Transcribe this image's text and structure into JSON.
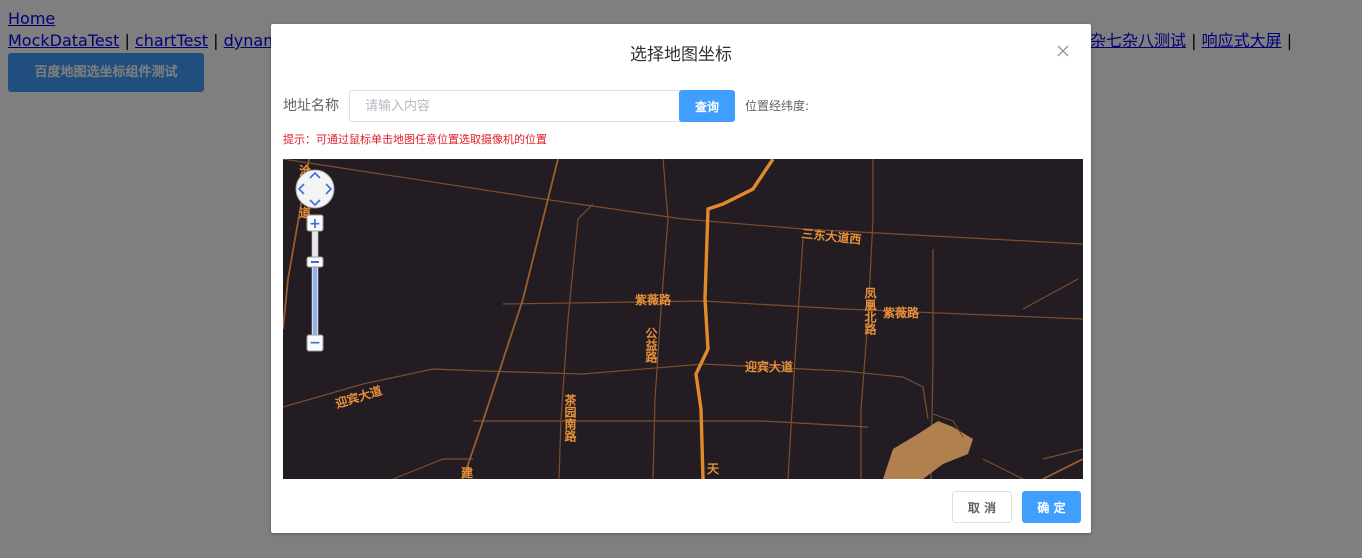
{
  "background": {
    "nav_home": "Home",
    "nav_links": [
      "MockDataTest",
      "chartTest",
      "dynamic"
    ],
    "nav_links_right": [
      "杂七杂八测试",
      "响应式大屏"
    ],
    "separator": "|",
    "primary_button": "百度地图选坐标组件测试"
  },
  "dialog": {
    "title": "选择地图坐标",
    "close_icon": "close-icon",
    "address_label": "地址名称",
    "address_placeholder": "请输入内容",
    "address_value": "",
    "query_button": "查询",
    "coord_label": "位置经纬度:",
    "tip": "提示：可通过鼠标单击地图任意位置选取摄像机的位置",
    "cancel_button": "取 消",
    "confirm_button": "确 定"
  },
  "map": {
    "theme_colors": {
      "background": "#231c23",
      "road": "#8a5a34",
      "highway": "#e08a2c",
      "label": "#e6903a",
      "park": "#b0814f"
    },
    "labels": {
      "road_sandong": "三东大道西",
      "road_ziwei_1": "紫薇路",
      "road_ziwei_2": "紫薇路",
      "road_gongyi": "公益路",
      "road_fenghuang": "凤凰北路",
      "road_yingbin_1": "迎宾大道",
      "road_yingbin_2": "迎宾大道",
      "road_chayuan": "茶园南路",
      "road_tian": "天",
      "road_jian": "建",
      "road_fragment_top_1": "沧",
      "road_fragment_top_2": "道"
    },
    "controls": {
      "pan_icon": "pan-control-icon",
      "zoom_in_icon": "zoom-in-icon",
      "zoom_out_icon": "zoom-out-icon",
      "zoom_slider_icon": "zoom-slider-icon",
      "zoom_in_symbol": "+",
      "zoom_out_symbol": "−"
    }
  }
}
